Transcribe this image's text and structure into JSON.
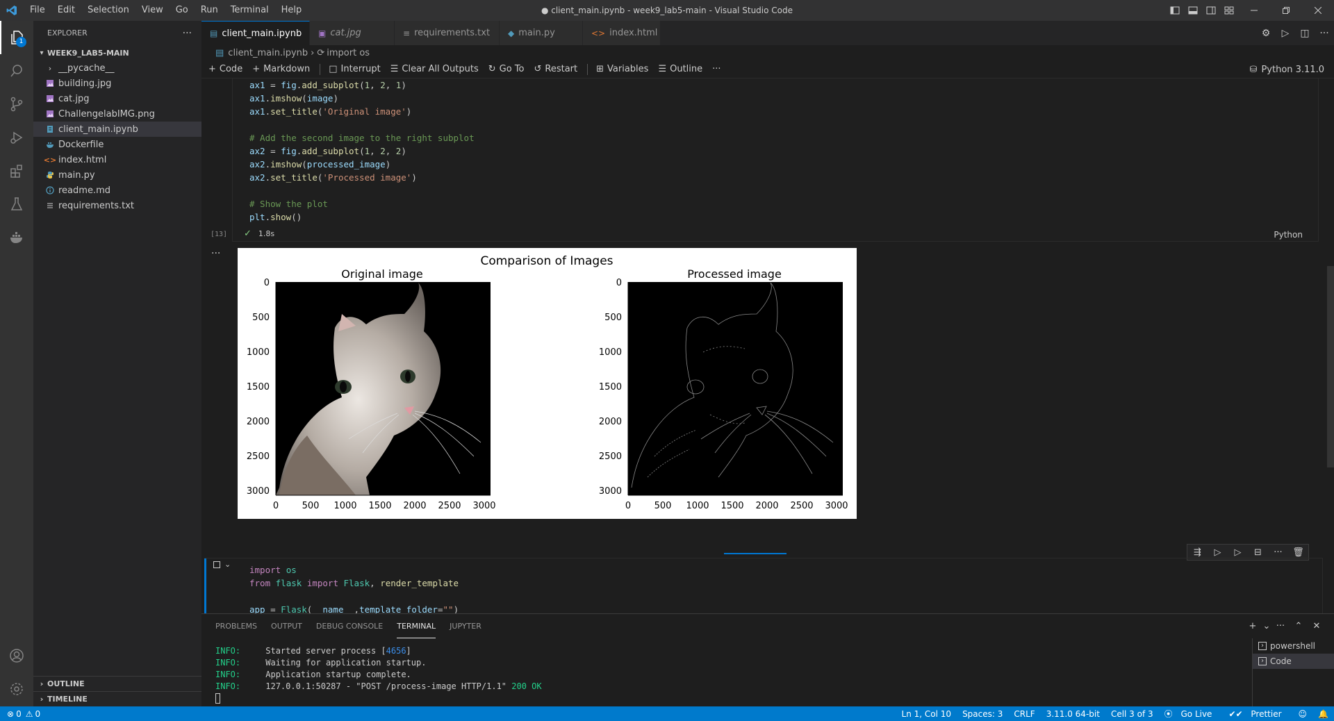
{
  "window": {
    "title": "● client_main.ipynb - week9_lab5-main - Visual Studio Code"
  },
  "menu": [
    "File",
    "Edit",
    "Selection",
    "View",
    "Go",
    "Run",
    "Terminal",
    "Help"
  ],
  "sidebar": {
    "header": "EXPLORER",
    "root": "WEEK9_LAB5-MAIN",
    "items": [
      {
        "label": "__pycache__",
        "icon": "chevron-right-icon",
        "color": "#cccccc"
      },
      {
        "label": "building.jpg",
        "icon": "image-file-icon",
        "color": "#a074c4"
      },
      {
        "label": "cat.jpg",
        "icon": "image-file-icon",
        "color": "#a074c4"
      },
      {
        "label": "ChallengelabIMG.png",
        "icon": "image-file-icon",
        "color": "#a074c4"
      },
      {
        "label": "client_main.ipynb",
        "icon": "notebook-file-icon",
        "color": "#519aba",
        "selected": true
      },
      {
        "label": "Dockerfile",
        "icon": "docker-file-icon",
        "color": "#519aba"
      },
      {
        "label": "index.html",
        "icon": "html-file-icon",
        "color": "#e37933"
      },
      {
        "label": "main.py",
        "icon": "python-file-icon",
        "color": "#519aba"
      },
      {
        "label": "readme.md",
        "icon": "info-file-icon",
        "color": "#519aba"
      },
      {
        "label": "requirements.txt",
        "icon": "text-file-icon",
        "color": "#cccccc"
      }
    ],
    "outline": "OUTLINE",
    "timeline": "TIMELINE"
  },
  "tabs": [
    {
      "label": "client_main.ipynb",
      "active": true,
      "dirty": true,
      "icon": "notebook-file-icon"
    },
    {
      "label": "cat.jpg",
      "icon": "image-file-icon"
    },
    {
      "label": "requirements.txt",
      "icon": "text-file-icon"
    },
    {
      "label": "main.py",
      "icon": "python-file-icon"
    },
    {
      "label": "index.html",
      "icon": "html-file-icon"
    }
  ],
  "breadcrumb": {
    "file": "client_main.ipynb",
    "symbol": "import os"
  },
  "toolbar": {
    "code": "Code",
    "markdown": "Markdown",
    "interrupt": "Interrupt",
    "clear_outputs": "Clear All Outputs",
    "goto": "Go To",
    "restart": "Restart",
    "variables": "Variables",
    "outline": "Outline",
    "more": "···",
    "kernel": "Python 3.11.0"
  },
  "cell1": {
    "lines": [
      "ax1 = fig.add_subplot(1, 2, 1)",
      "ax1.imshow(image)",
      "ax1.set_title('Original image')",
      "",
      "# Add the second image to the right subplot",
      "ax2 = fig.add_subplot(1, 2, 2)",
      "ax2.imshow(processed_image)",
      "ax2.set_title('Processed image')",
      "",
      "# Show the plot",
      "plt.show()"
    ],
    "exec_count": "[13]",
    "duration": "1.8s",
    "language": "Python",
    "output_menu": "···"
  },
  "figure": {
    "suptitle": "Comparison of Images",
    "left_title": "Original image",
    "right_title": "Processed image",
    "yticks": [
      "0",
      "500",
      "1000",
      "1500",
      "2000",
      "2500",
      "3000"
    ],
    "xticks": [
      "0",
      "500",
      "1000",
      "1500",
      "2000",
      "2500",
      "3000"
    ]
  },
  "cell2": {
    "lines": [
      "import os",
      "from flask import Flask, render_template",
      "",
      "app = Flask(__name__,template_folder=\"\")"
    ]
  },
  "panel": {
    "tabs": [
      "PROBLEMS",
      "OUTPUT",
      "DEBUG CONSOLE",
      "TERMINAL",
      "JUPYTER"
    ],
    "active_tab": "TERMINAL",
    "terminal": [
      {
        "level": "INFO:",
        "text": "Started server process [",
        "num": "4656",
        "tail": "]"
      },
      {
        "level": "INFO:",
        "text": "Waiting for application startup."
      },
      {
        "level": "INFO:",
        "text": "Application startup complete."
      },
      {
        "level": "INFO:",
        "text": "127.0.0.1:50287 - \"POST /process-image HTTP/1.1\" ",
        "ok": "200 OK"
      }
    ],
    "terminals": [
      "powershell",
      "Code"
    ]
  },
  "status": {
    "errors": "0",
    "warnings": "0",
    "position": "Ln 1, Col 10",
    "spaces": "Spaces: 3",
    "eol": "CRLF",
    "python": "3.11.0 64-bit",
    "cell": "Cell 3 of 3",
    "golive": "Go Live",
    "prettier": "Prettier"
  }
}
